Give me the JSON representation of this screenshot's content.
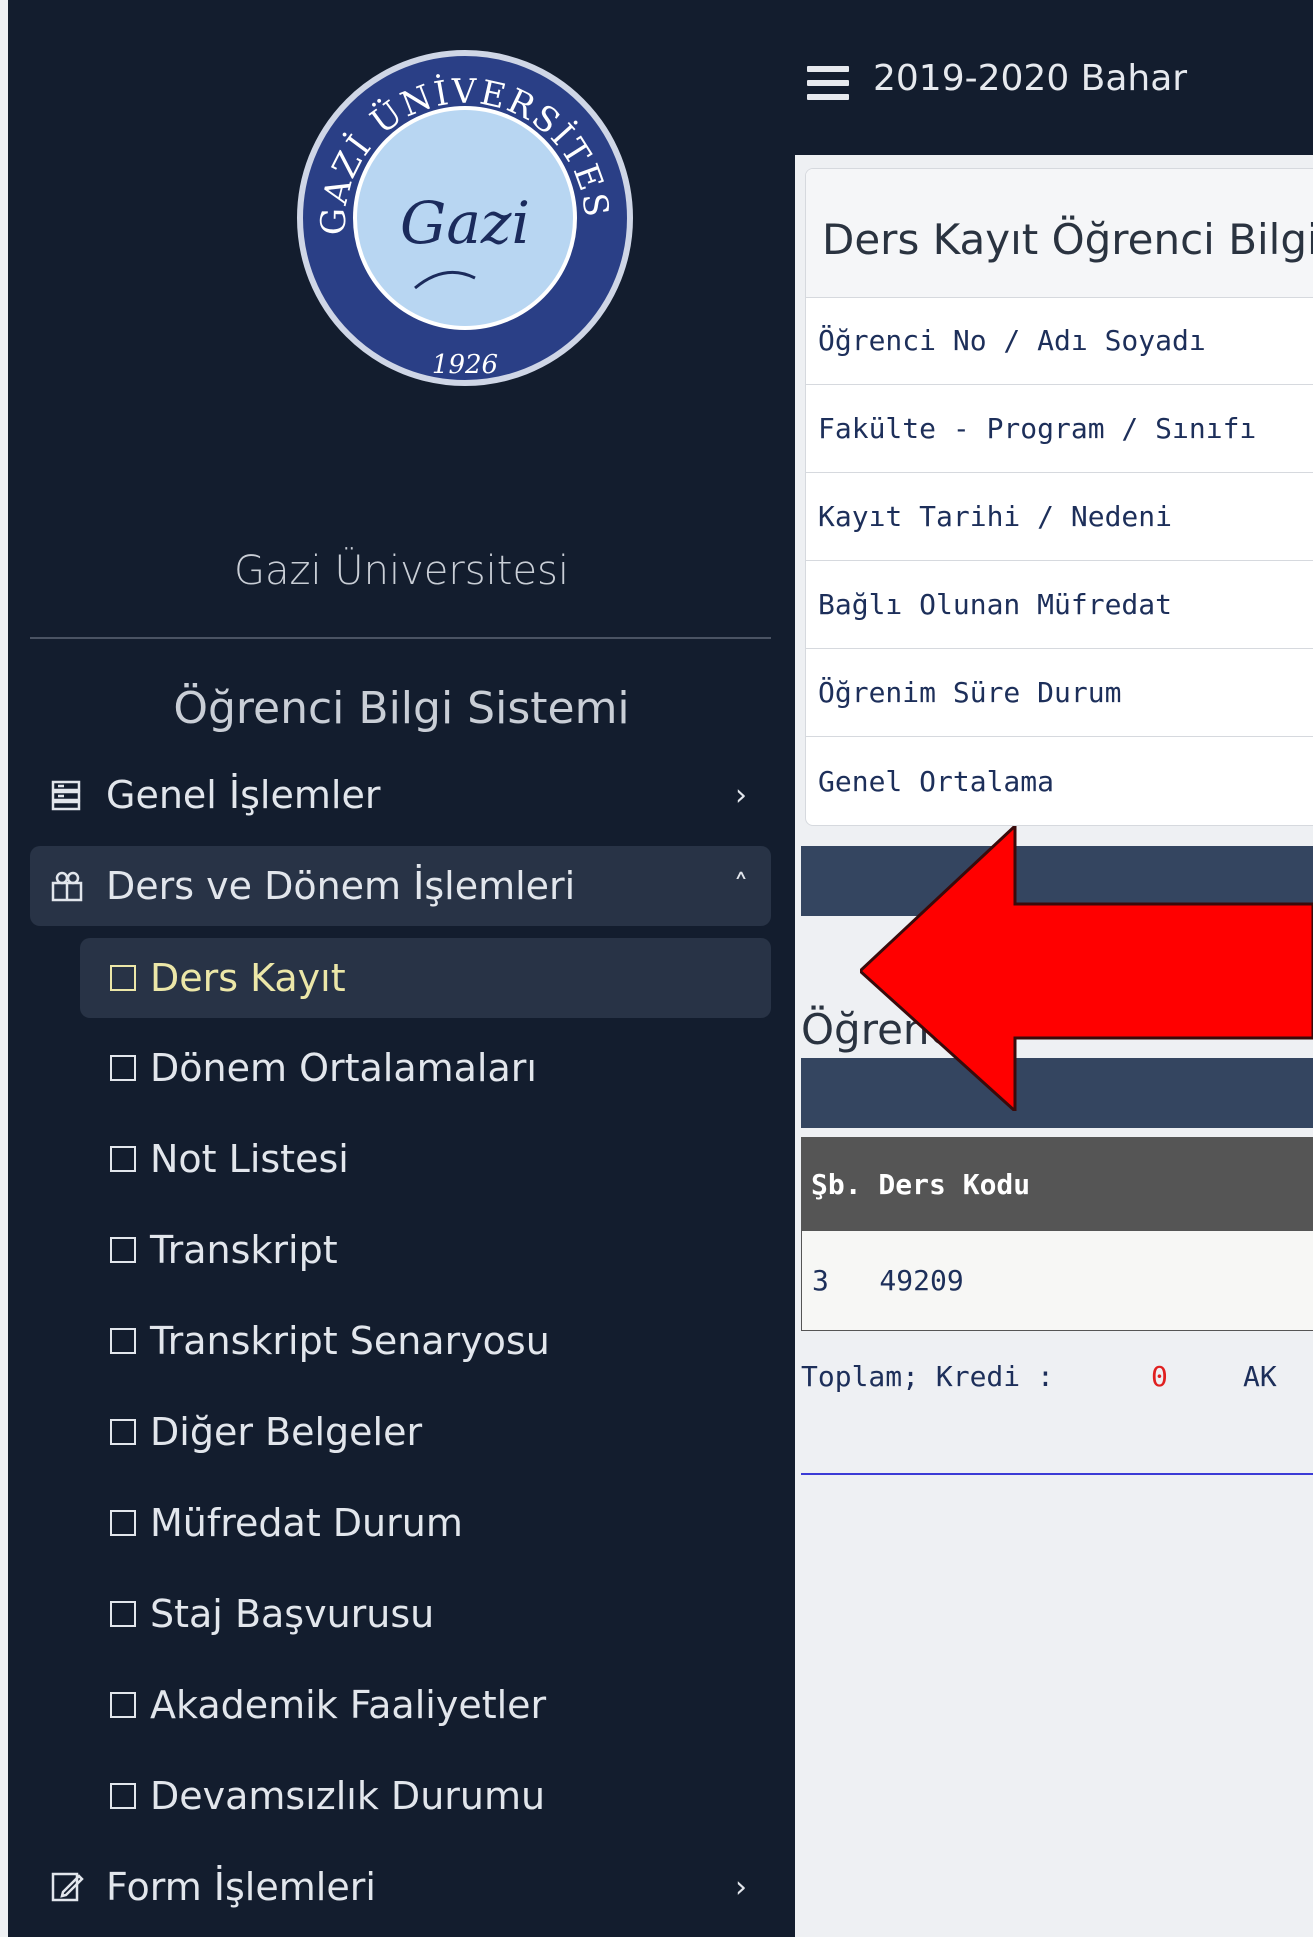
{
  "sidebar": {
    "logo": {
      "ring_text": "GAZİ ÜNİVERSİTESİ",
      "signature": "Gazi",
      "year": "1926"
    },
    "org_name": "Gazi Üniversitesi",
    "app_name": "Öğrenci Bilgi Sistemi",
    "menu": {
      "genel": {
        "label": "Genel İşlemler",
        "icon": "server-icon",
        "chevron": "›"
      },
      "ders_donem": {
        "label": "Ders ve Dönem İşlemleri",
        "icon": "users-icon",
        "chevron": "˄"
      },
      "form": {
        "label": "Form İşlemleri",
        "icon": "edit-form-icon",
        "chevron": "›"
      }
    },
    "sub_items": [
      "Ders Kayıt",
      "Dönem Ortalamaları",
      "Not Listesi",
      "Transkript",
      "Transkript Senaryosu",
      "Diğer Belgeler",
      "Müfredat Durum",
      "Staj Başvurusu",
      "Akademik Faaliyetler",
      "Devamsızlık Durumu"
    ],
    "active_item": "Ders Kayıt"
  },
  "topbar": {
    "term": "2019-2020 Bahar",
    "menu_icon": "hamburger-icon"
  },
  "card": {
    "title": "Ders Kayıt Öğrenci Bilgiler",
    "rows": [
      "Öğrenci No / Adı Soyadı",
      "Fakülte - Program / Sınıfı",
      "Kayıt Tarihi / Nedeni",
      "Bağlı Olunan Müfredat",
      "Öğrenim Süre Durum",
      "Genel Ortalama"
    ]
  },
  "section_title": "Öğrenci",
  "table": {
    "header": "Şb. Ders Kodu",
    "row": "3   49209"
  },
  "totals": {
    "label": "Toplam; Kredi :",
    "value": "0",
    "next": "AK"
  },
  "overlay": {
    "type": "red-left-arrow",
    "color": "#ff0000"
  }
}
